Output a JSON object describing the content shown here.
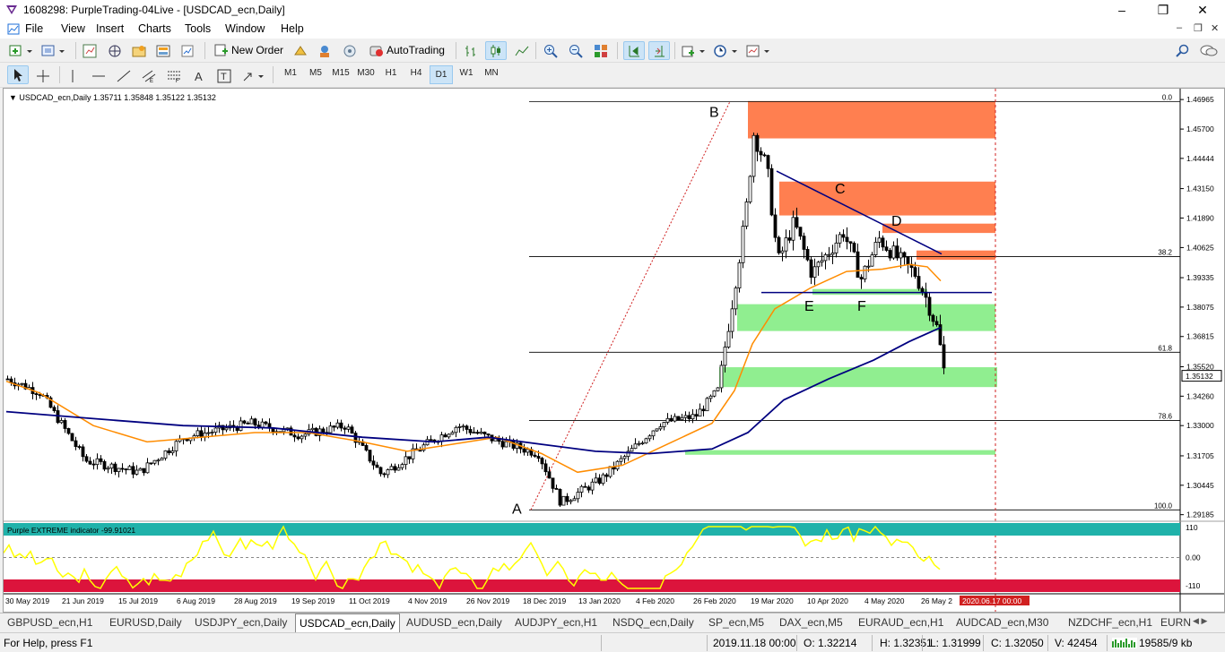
{
  "window": {
    "title": "1608298: PurpleTrading-04Live - [USDCAD_ecn,Daily]"
  },
  "menu": [
    "File",
    "Insert",
    "Charts",
    "Tools",
    "Window",
    "Help"
  ],
  "toolbar": {
    "new_order": "New Order",
    "auto_trading": "AutoTrading"
  },
  "timeframes": [
    "M1",
    "M5",
    "M15",
    "M30",
    "H1",
    "H4",
    "D1",
    "W1",
    "MN"
  ],
  "chart": {
    "header": "USDCAD_ecn,Daily  1.35711 1.35848 1.35122 1.35132",
    "price_labels": [
      "1.46965",
      "1.45700",
      "1.44444",
      "1.43150",
      "1.41890",
      "1.40625",
      "1.39335",
      "1.38075",
      "1.36815",
      "1.35520",
      "1.34260",
      "1.33000",
      "1.31705",
      "1.30445",
      "1.29185"
    ],
    "current_price": "1.35132",
    "fib_levels": [
      "0.0",
      "38.2",
      "61.8",
      "78.6",
      "100.0"
    ],
    "pattern_labels": [
      "A",
      "B",
      "C",
      "D",
      "E",
      "F"
    ],
    "date_labels": [
      "30 May 2019",
      "21 Jun 2019",
      "15 Jul 2019",
      "6 Aug 2019",
      "28 Aug 2019",
      "19 Sep 2019",
      "11 Oct 2019",
      "4 Nov 2019",
      "26 Nov 2019",
      "18 Dec 2019",
      "13 Jan 2020",
      "4 Feb 2020",
      "26 Feb 2020",
      "19 Mar 2020",
      "10 Apr 2020",
      "4 May 2020",
      "26 May 2"
    ],
    "date_marker": "2020.06.17 00:00",
    "colors": {
      "resistance": "#ff7f50",
      "support": "#90ee90",
      "ma_fast": "#ff8c00",
      "ma_slow": "#000080",
      "indicator": "#ffff00",
      "ob_band": "#20b2aa",
      "os_band": "#dc143c"
    }
  },
  "indicator": {
    "label": "Purple EXTREME indicator -99.91021",
    "levels": [
      "110",
      "0.00",
      "-110"
    ]
  },
  "tabs": [
    "GBPUSD_ecn,H1",
    "EURUSD,Daily",
    "USDJPY_ecn,Daily",
    "USDCAD_ecn,Daily",
    "AUDUSD_ecn,Daily",
    "AUDJPY_ecn,H1",
    "NSDQ_ecn,Daily",
    "SP_ecn,M5",
    "DAX_ecn,M5",
    "EURAUD_ecn,H1",
    "AUDCAD_ecn,M30",
    "NZDCHF_ecn,H1",
    "EURN"
  ],
  "active_tab": "USDCAD_ecn,Daily",
  "status": {
    "help": "For Help, press F1",
    "time": "2019.11.18 00:00",
    "open": "O: 1.32214",
    "high": "H: 1.32351",
    "low": "L: 1.31999",
    "close": "C: 1.32050",
    "volume": "V: 42454",
    "traffic": "19585/9 kb"
  }
}
